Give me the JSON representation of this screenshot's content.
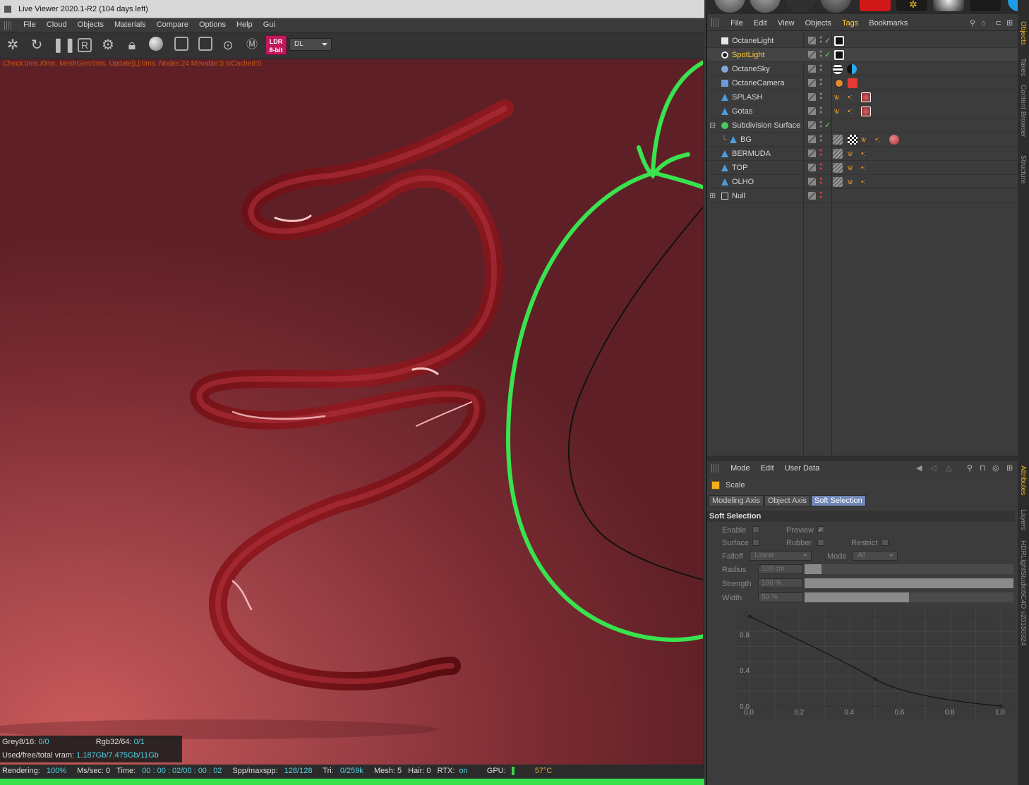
{
  "viewer": {
    "title": "Live Viewer 2020.1-R2 (104 days left)",
    "menu": [
      "File",
      "Cloud",
      "Objects",
      "Materials",
      "Compare",
      "Options",
      "Help",
      "Gui"
    ],
    "ldr_badge": "LDR 8-bit",
    "mode_select": "DL",
    "stats": "Check:0ms./0ms. MeshGen:0ms. Update[L]:0ms. Nodes:24 Movable:3 txCached:0",
    "info": {
      "grey_label": "Grey8/16:",
      "grey_value": "0/0",
      "rgb_label": "Rgb32/64:",
      "rgb_value": "0/1",
      "vram_label": "Used/free/total vram:",
      "vram_value": "1.187Gb/7.475Gb/11Gb"
    },
    "status": {
      "rendering_label": "Rendering:",
      "rendering_value": "100%",
      "mssec": "Ms/sec: 0",
      "time_label": "Time:",
      "time_value": "00 : 00 : 02/00 : 00 : 02",
      "spp_label": "Spp/maxspp:",
      "spp_value": "128/128",
      "tri_label": "Tri:",
      "tri_value": "0/259k",
      "mesh": "Mesh: 5",
      "hair": "Hair: 0",
      "rtx_label": "RTX:",
      "rtx_value": "on",
      "gpu_label": "GPU:",
      "temp": "57°C"
    },
    "progress": 1.0
  },
  "object_manager": {
    "menu": [
      "File",
      "Edit",
      "View",
      "Objects",
      "Tags",
      "Bookmarks"
    ],
    "active_menu": "Tags",
    "objects": [
      {
        "name": "OctaneLight",
        "icon": "light-icon",
        "selected": false
      },
      {
        "name": "SpotLight",
        "icon": "spotlight-icon",
        "selected": true
      },
      {
        "name": "OctaneSky",
        "icon": "sky-icon",
        "selected": false
      },
      {
        "name": "OctaneCamera",
        "icon": "camera-icon",
        "selected": false
      },
      {
        "name": "SPLASH",
        "icon": "mesh-icon",
        "selected": false
      },
      {
        "name": "Gotas",
        "icon": "mesh-icon",
        "selected": false
      },
      {
        "name": "Subdivision Surface",
        "icon": "subdivision-icon",
        "selected": false
      },
      {
        "name": "BG",
        "icon": "mesh-icon",
        "selected": false
      },
      {
        "name": "BERMUDA",
        "icon": "mesh-icon",
        "selected": false
      },
      {
        "name": "TOP",
        "icon": "mesh-icon",
        "selected": false
      },
      {
        "name": "OLHO",
        "icon": "mesh-icon",
        "selected": false
      },
      {
        "name": "Null",
        "icon": "null-icon",
        "selected": false
      }
    ]
  },
  "attributes": {
    "menu": [
      "Mode",
      "Edit",
      "User Data"
    ],
    "tool_name": "Scale",
    "tabs": [
      "Modeling Axis",
      "Object Axis",
      "Soft Selection"
    ],
    "active_tab": "Soft Selection",
    "section": "Soft Selection",
    "fields": {
      "enable": "Enable",
      "preview": "Preview",
      "surface": "Surface",
      "rubber": "Rubber",
      "restrict": "Restrict",
      "falloff": "Falloff",
      "falloff_value": "Linear",
      "mode": "Mode",
      "mode_value": "All",
      "radius": "Radius",
      "radius_value": "100 cm",
      "strength": "Strength",
      "strength_value": "100 %",
      "width": "Width",
      "width_value": "50 %"
    },
    "radius_level": 0.08,
    "strength_level": 1.0,
    "width_level": 0.5,
    "graph": {
      "y_ticks": [
        "0.8",
        "0.4",
        "0.0"
      ],
      "x_ticks": [
        "0.0",
        "0.2",
        "0.4",
        "0.6",
        "0.8",
        "1.0"
      ],
      "curve": [
        [
          0,
          1
        ],
        [
          0.5,
          0.3
        ],
        [
          1,
          0
        ]
      ]
    }
  },
  "side_tabs": {
    "top": [
      "Objects",
      "Takes",
      "Content Browser",
      "Structure"
    ],
    "bottom": [
      "Attributes",
      "Layers",
      "HDRLightStudio5C4D v20150324"
    ]
  },
  "colors": {
    "annotation": "#39e34f",
    "accent_selected": "#ffcc33",
    "active_tab": "#6e87b6"
  }
}
